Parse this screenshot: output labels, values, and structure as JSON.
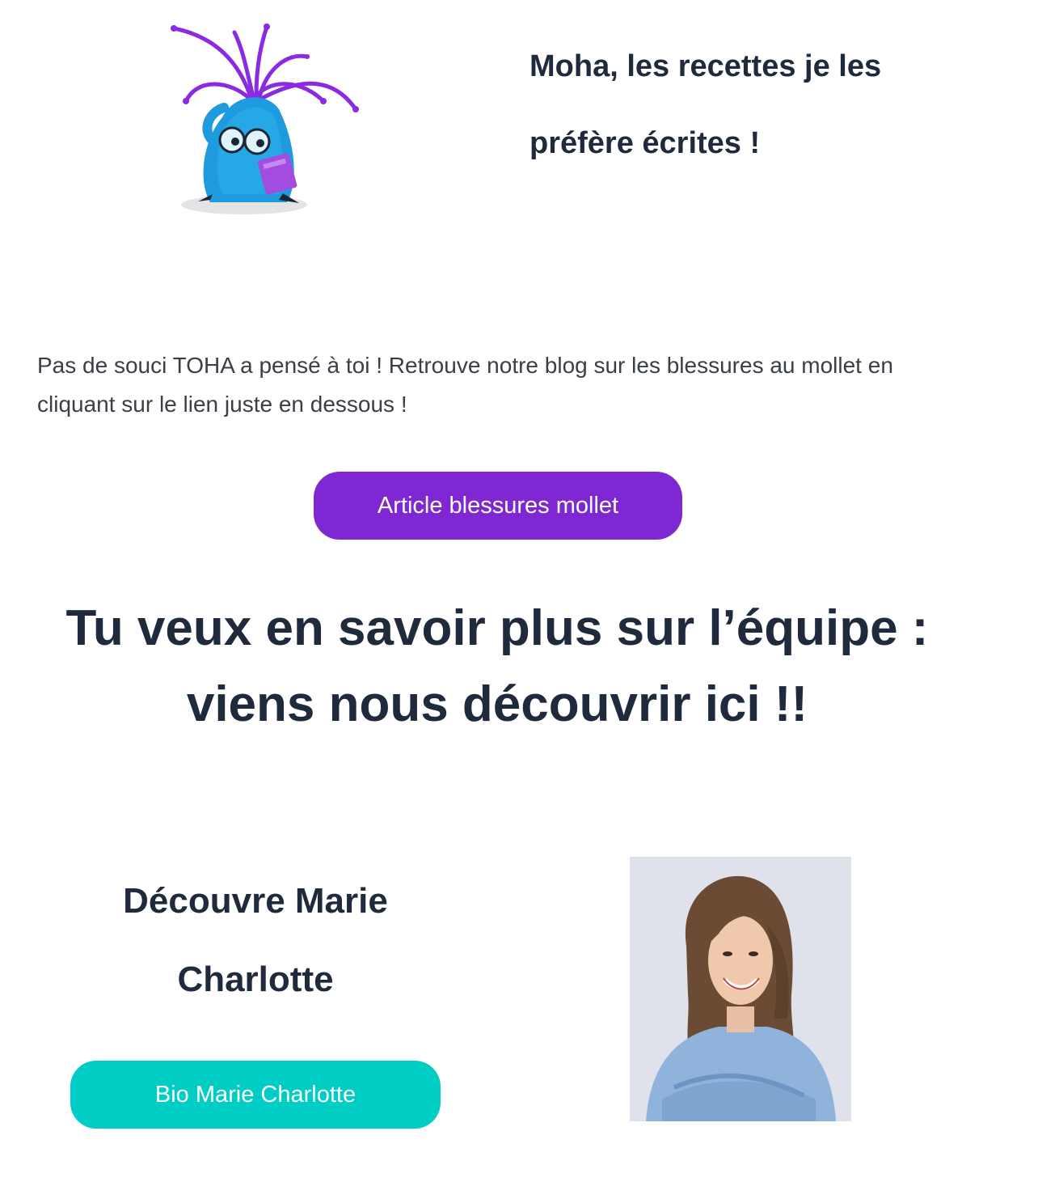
{
  "top_heading": {
    "line1": "Moha, les recettes je les",
    "line2": "préfère écrites !"
  },
  "intro_text": "Pas de souci TOHA a pensé à toi ! Retrouve notre blog sur les blessures au mollet en cliquant sur le lien juste en dessous !",
  "article_button_label": "Article blessures mollet",
  "team_heading": {
    "line1": "Tu veux en savoir plus sur l’équipe :",
    "line2": "viens nous découvrir ici !!"
  },
  "discover_heading": {
    "line1": "Découvre Marie",
    "line2": "Charlotte"
  },
  "bio_button_label": "Bio Marie Charlotte",
  "colors": {
    "text_dark": "#1f2a3c",
    "purple_button": "#7f27d2",
    "teal_button": "#00cdc4"
  },
  "images": {
    "mascot": "blue-monster-with-purple-hair-glasses-book-illustration",
    "photo": "portrait-woman-blue-shirt-arms-crossed"
  }
}
